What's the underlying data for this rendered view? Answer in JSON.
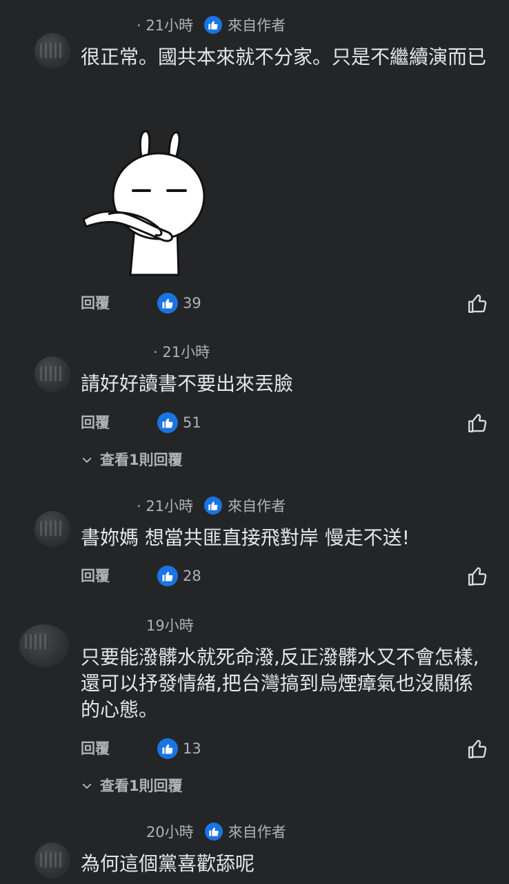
{
  "common": {
    "reply_label": "回覆",
    "author_label": "來自作者",
    "view_replies_label": "查看1則回覆"
  },
  "comments": [
    {
      "time": "· 21小時",
      "text": "很正常。國共本來就不分家。只是不繼續演而已",
      "likes": "39"
    },
    {
      "time": "· 21小時",
      "text": "請好好讀書不要出來丟臉",
      "likes": "51"
    },
    {
      "time": "· 21小時",
      "text": "書妳媽 想當共匪直接飛對岸 慢走不送!",
      "likes": "28"
    },
    {
      "time": "19小時",
      "text": "只要能潑髒水就死命潑,反正潑髒水又不會怎樣,還可以抒發情緒,把台灣搞到烏煙瘴氣也沒關係的心態。",
      "likes": "13"
    },
    {
      "time": "20小時",
      "text": "為何這個黨喜歡舔呢"
    }
  ],
  "colors": {
    "background": "#242526",
    "text_primary": "#e4e6eb",
    "text_secondary": "#b0b3b8",
    "accent_blue": "#1b74e4"
  },
  "icons": {
    "author_badge": "thumbs-up-icon",
    "like_badge": "thumbs-up-icon",
    "like_button": "thumbs-up-outline-icon",
    "expand": "chevron-down-icon"
  }
}
